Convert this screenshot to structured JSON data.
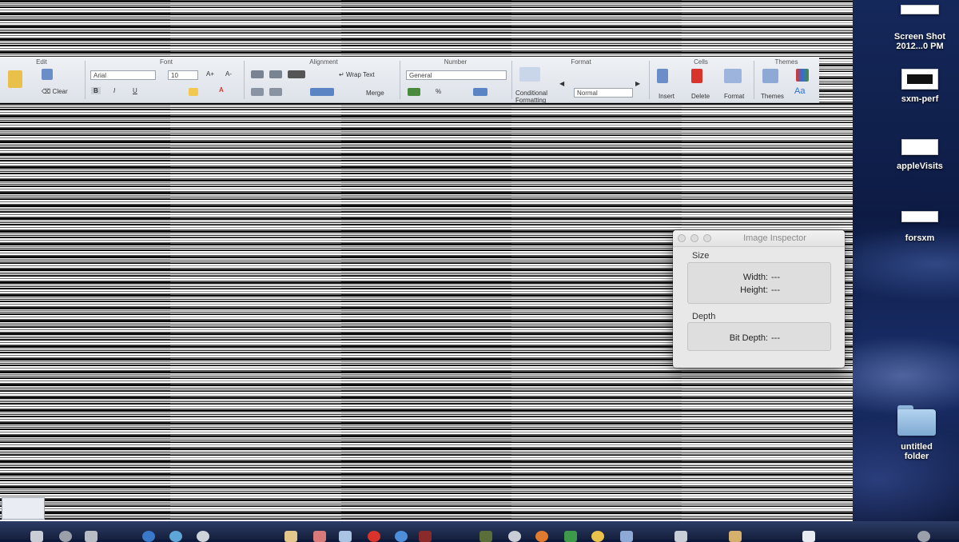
{
  "excel": {
    "ribbon_groups": [
      "Edit",
      "Font",
      "Alignment",
      "Number",
      "Format",
      "Cells",
      "Themes"
    ],
    "font_name": "Arial",
    "font_size": "10",
    "number_format": "General",
    "clear_label": "Clear",
    "wrap_text_label": "Wrap Text",
    "merge_label": "Merge",
    "conditional_label": "Conditional",
    "formatting_label": "Formatting",
    "normal_label": "Normal",
    "insert_label": "Insert",
    "delete_label": "Delete",
    "format_label": "Format",
    "themes_label": "Themes",
    "bold": "B",
    "italic": "I",
    "underline": "U",
    "percent": "%",
    "font_color": "A",
    "themes_aa": "Aa"
  },
  "inspector": {
    "title": "Image Inspector",
    "size_section": "Size",
    "width_label": "Width:",
    "width_value": "---",
    "height_label": "Height:",
    "height_value": "---",
    "depth_section": "Depth",
    "bit_depth_label": "Bit Depth:",
    "bit_depth_value": "---"
  },
  "desktop": {
    "items": [
      {
        "line1": "Screen Shot",
        "line2": "2012...0 PM"
      },
      {
        "line1": "sxm-perf",
        "line2": ""
      },
      {
        "line1": "appleVisits",
        "line2": ""
      },
      {
        "line1": "forsxm",
        "line2": ""
      },
      {
        "line1": "untitled",
        "line2": "folder"
      }
    ]
  },
  "colors": {
    "accent_red": "#d9342b",
    "accent_blue": "#2f6fd6",
    "folder_blue": "#9cc3e6"
  }
}
